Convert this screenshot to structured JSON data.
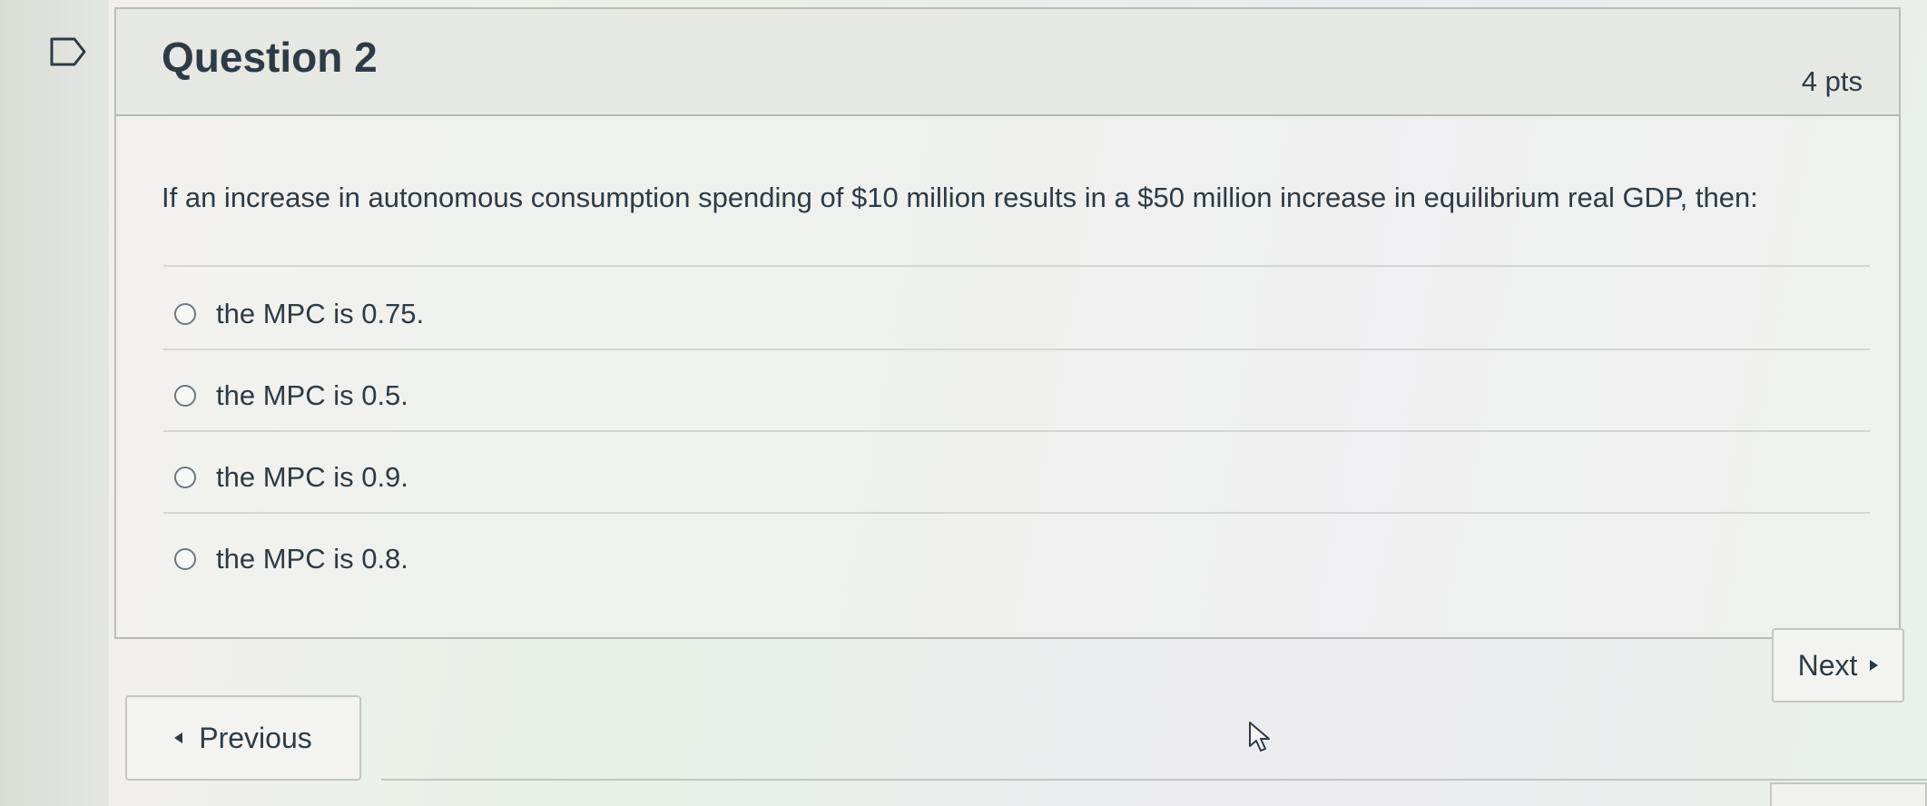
{
  "question": {
    "title": "Question 2",
    "points": "4 pts",
    "text": "If an increase in autonomous consumption spending of $10 million results in a $50 million increase in equilibrium real GDP, then:",
    "answers": [
      {
        "label": "the MPC is 0.75."
      },
      {
        "label": "the MPC is 0.5."
      },
      {
        "label": "the MPC is 0.9."
      },
      {
        "label": "the MPC is 0.8."
      }
    ]
  },
  "navigation": {
    "next_label": "Next",
    "previous_label": "Previous"
  },
  "icons": {
    "flag": "flag-icon",
    "next": "triangle-right-icon",
    "previous": "triangle-left-icon",
    "cursor": "mouse-pointer-icon"
  },
  "colors": {
    "text": "#2d3b45",
    "border": "#b8bdb7",
    "header_bg": "#e4e6e2"
  }
}
